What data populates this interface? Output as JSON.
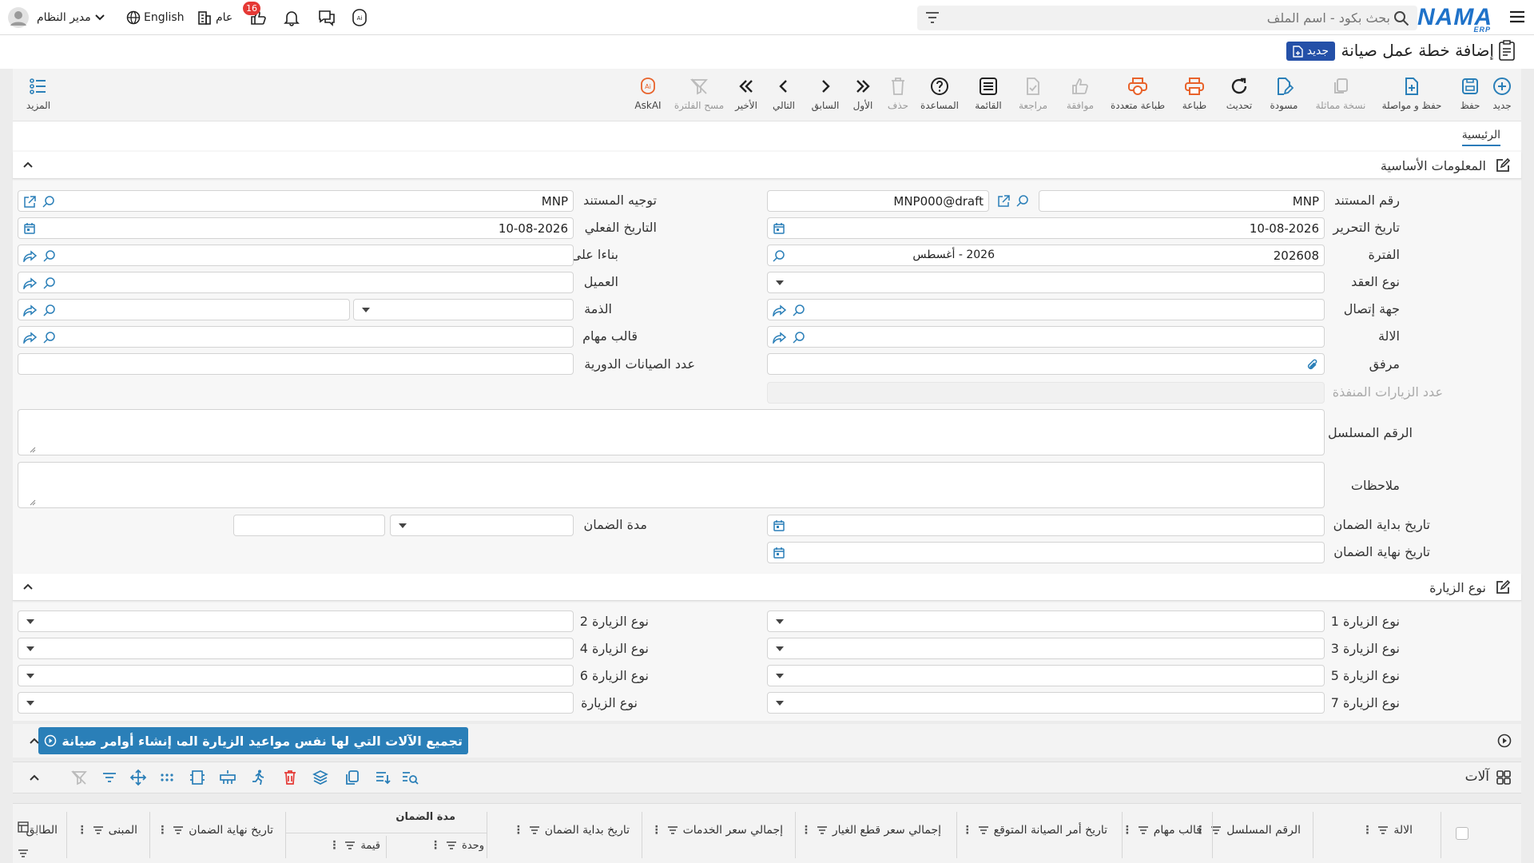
{
  "topbar": {
    "search_placeholder": "بحث بكود - اسم الملف",
    "logo_text": "NAMA",
    "logo_sub": "ERP",
    "user_label": "مدير النظام",
    "language_label": "English",
    "general_label": "عام",
    "notification_count": "16"
  },
  "page": {
    "title": "إضافة خطة عمل صيانة",
    "status_badge": "جديد"
  },
  "toolbar": {
    "new": "جديد",
    "save": "حفظ",
    "save_continue": "حفظ و مواصلة",
    "duplicate": "نسخة مماثلة",
    "draft": "مسودة",
    "refresh": "تحديث",
    "print": "طباعة",
    "multi_print": "طباعة متعددة",
    "approve": "موافقة",
    "review": "مراجعة",
    "list": "القائمة",
    "help": "المساعدة",
    "delete": "حذف",
    "first": "الأول",
    "previous": "السابق",
    "next": "التالي",
    "last": "الأخير",
    "clear_filter": "مسح الفلترة",
    "askai": "AskAI",
    "more": "المزيد"
  },
  "tabs": {
    "main": "الرئيسية"
  },
  "basic": {
    "title": "المعلومات الأساسية",
    "doc_number_label": "رقم المستند",
    "doc_number_prefix": "MNP",
    "doc_number_value": "MNP000@draft",
    "direction_label": "توجيه المستند",
    "direction_value": "MNP",
    "edit_date_label": "تاريخ التحرير",
    "edit_date_value": "10-08-2026",
    "actual_date_label": "التاريخ الفعلي",
    "actual_date_value": "10-08-2026",
    "period_label": "الفترة",
    "period_code": "202608",
    "period_name": "2026 - أغسطس",
    "based_on_label": "بناءا على",
    "contract_type_label": "نوع العقد",
    "customer_label": "العميل",
    "contact_label": "جهة إتصال",
    "account_label": "الذمة",
    "machine_label": "الالة",
    "task_template_label": "قالب مهام",
    "attachment_label": "مرفق",
    "periodic_count_label": "عدد الصيانات الدورية",
    "executed_visits_label": "عدد الزيارات المنفذة",
    "serial_label": "الرقم المسلسل",
    "notes_label": "ملاحظات",
    "warranty_start_label": "تاريخ بداية الضمان",
    "warranty_period_label": "مدة الضمان",
    "warranty_end_label": "تاريخ نهاية الضمان"
  },
  "visits": {
    "title": "نوع الزيارة",
    "v1": "نوع الزيارة 1",
    "v2": "نوع الزيارة 2",
    "v3": "نوع الزيارة 3",
    "v4": "نوع الزيارة 4",
    "v5": "نوع الزيارة 5",
    "v6": "نوع الزيارة 6",
    "v7": "نوع الزيارة 7",
    "v8": "نوع الزيارة"
  },
  "actions": {
    "group_machines": "تجميع الآلات التي لها نفس مواعيد الزيارة المحددة",
    "create_orders": "إنشاء أوامر صيانة"
  },
  "machines": {
    "title": "آلات",
    "columns": {
      "machine": "الالة",
      "serial": "الرقم المسلسل",
      "task_template": "قالب مهام",
      "expected_date": "تاريخ أمر الصيانة المتوقع",
      "parts_total": "إجمالي سعر قطع الغيار",
      "services_total": "إجمالي سعر الخدمات",
      "warranty_start": "تاريخ بداية الضمان",
      "warranty_period": "مدة الضمان",
      "unit": "وحدة",
      "value": "قيمة",
      "warranty_end": "تاريخ نهاية الضمان",
      "building": "المبنى",
      "floor": "الطابق",
      "cut": "الـ"
    }
  },
  "colors": {
    "primary": "#2a7fb8",
    "badge_red": "#e53935",
    "new_badge": "#2450a8",
    "print_orange": "#e8622a"
  }
}
